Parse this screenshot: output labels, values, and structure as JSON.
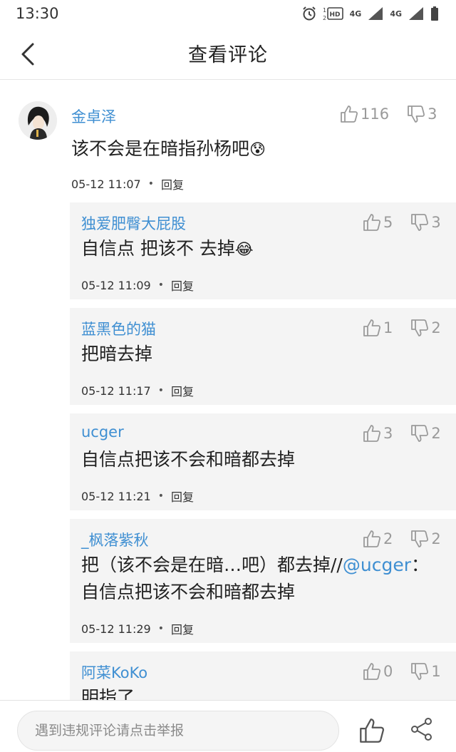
{
  "status_bar": {
    "time": "13:30",
    "net1": "4G",
    "net2": "4G"
  },
  "header": {
    "title": "查看评论"
  },
  "main_comment": {
    "username": "金卓泽",
    "text": "该不会是在暗指孙杨吧",
    "emoji": "😰",
    "time": "05-12 11:07",
    "reply_label": "回复",
    "likes": "116",
    "dislikes": "3"
  },
  "replies": [
    {
      "username": "独爱肥臀大屁股",
      "text": "自信点 把该不 去掉",
      "emoji": "😂",
      "time": "05-12 11:09",
      "reply_label": "回复",
      "likes": "5",
      "dislikes": "3"
    },
    {
      "username": "蓝黑色的猫",
      "text": "把暗去掉",
      "time": "05-12 11:17",
      "reply_label": "回复",
      "likes": "1",
      "dislikes": "2"
    },
    {
      "username": "ucger",
      "text": "自信点把该不会和暗都去掉",
      "time": "05-12 11:21",
      "reply_label": "回复",
      "likes": "3",
      "dislikes": "2"
    },
    {
      "username": "_枫落紫秋",
      "text_part1": "把（该不会是在暗…吧）都去掉//",
      "mention": "@ucger",
      "text_part2": "：",
      "text_line2": "自信点把该不会和暗都去掉",
      "time": "05-12 11:29",
      "reply_label": "回复",
      "likes": "2",
      "dislikes": "2"
    },
    {
      "username": "阿菜KoKo",
      "text": "明指了",
      "likes": "0",
      "dislikes": "1"
    }
  ],
  "bottom_bar": {
    "report_placeholder": "遇到违规评论请点击举报"
  },
  "colors": {
    "username": "#3f8fd2",
    "reply_bg": "#f4f4f4",
    "vote_gray": "#9a9a9a"
  }
}
